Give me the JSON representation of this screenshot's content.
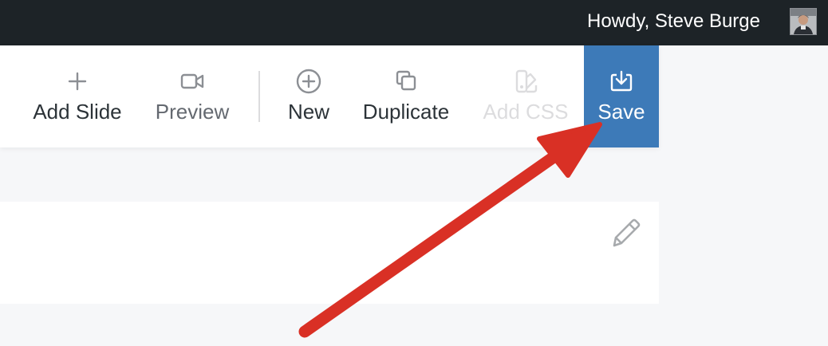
{
  "admin_bar": {
    "greeting": "Howdy, Steve Burge"
  },
  "toolbar": {
    "buttons": [
      {
        "label": "Add Slide",
        "icon": "plus-icon",
        "state": "enabled"
      },
      {
        "label": "Preview",
        "icon": "video-camera-icon",
        "state": "enabled"
      },
      {
        "label": "New",
        "icon": "plus-circle-icon",
        "state": "enabled"
      },
      {
        "label": "Duplicate",
        "icon": "duplicate-icon",
        "state": "enabled"
      },
      {
        "label": "Add CSS",
        "icon": "palette-icon",
        "state": "disabled"
      },
      {
        "label": "Save",
        "icon": "save-download-icon",
        "state": "active"
      }
    ]
  },
  "panel": {
    "edit_icon": "pencil-icon"
  },
  "annotation": {
    "type": "arrow",
    "color": "#d93025",
    "points_to": "save-button"
  },
  "colors": {
    "admin_bar_bg": "#1d2327",
    "save_button_bg": "#3d7ab8",
    "page_bg": "#f6f7f9"
  }
}
